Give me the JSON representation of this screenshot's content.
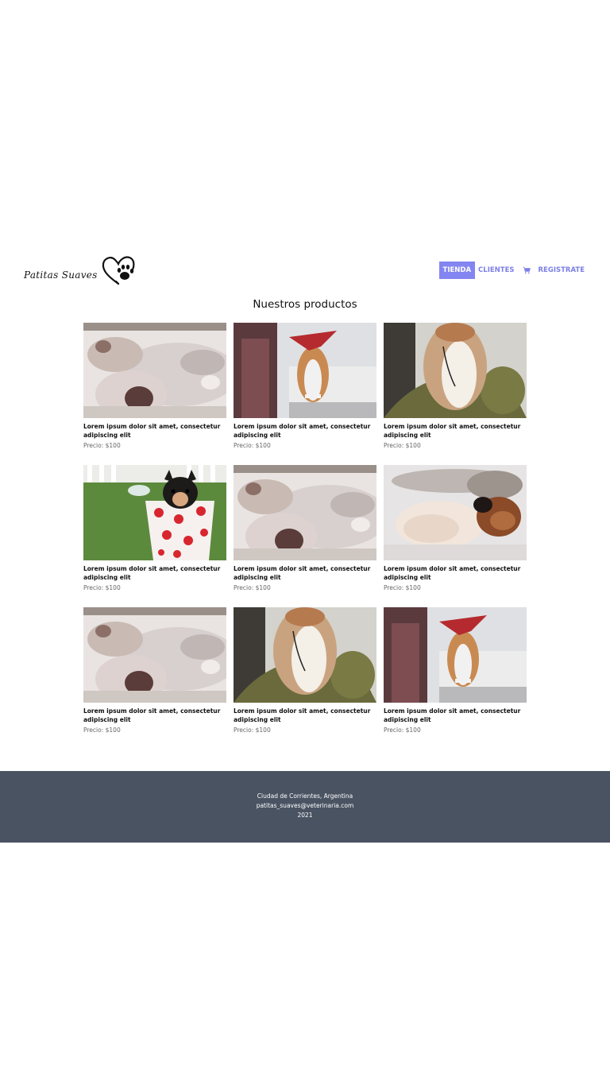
{
  "header": {
    "brand_name": "Patitas Suaves",
    "logo_icon": "heart-paw-icon",
    "nav": [
      {
        "label": "TIENDA",
        "active": true
      },
      {
        "label": "CLIENTES",
        "active": false
      },
      {
        "label": "REGISTRATE",
        "active": false,
        "icon": "cart-icon"
      }
    ]
  },
  "main": {
    "title": "Nuestros productos",
    "products": [
      {
        "image": "kitten-sleeping-photo",
        "description": "Lorem ipsum dolor sit amet, consectetur adipiscing elit",
        "price": "Precio: $100"
      },
      {
        "image": "cat-red-bandana-photo",
        "description": "Lorem ipsum dolor sit amet, consectetur adipiscing elit",
        "price": "Precio: $100"
      },
      {
        "image": "dog-on-chair-photo",
        "description": "Lorem ipsum dolor sit amet, consectetur adipiscing elit",
        "price": "Precio: $100"
      },
      {
        "image": "puppy-in-polka-dot-cup-photo",
        "description": "Lorem ipsum dolor sit amet, consectetur adipiscing elit",
        "price": "Precio: $100"
      },
      {
        "image": "kitten-sleeping-photo",
        "description": "Lorem ipsum dolor sit amet, consectetur adipiscing elit",
        "price": "Precio: $100"
      },
      {
        "image": "puppies-sleeping-photo",
        "description": "Lorem ipsum dolor sit amet, consectetur adipiscing elit",
        "price": "Precio: $100"
      },
      {
        "image": "kitten-sleeping-photo",
        "description": "Lorem ipsum dolor sit amet, consectetur adipiscing elit",
        "price": "Precio: $100"
      },
      {
        "image": "dog-on-chair-photo",
        "description": "Lorem ipsum dolor sit amet, consectetur adipiscing elit",
        "price": "Precio: $100"
      },
      {
        "image": "cat-red-bandana-photo",
        "description": "Lorem ipsum dolor sit amet, consectetur adipiscing elit",
        "price": "Precio: $100"
      }
    ]
  },
  "footer": {
    "location": "Ciudad de Corrientes, Argentina",
    "email": "patitas_suaves@veterinaria.com",
    "year": "2021"
  },
  "colors": {
    "nav_accent": "#8385f0",
    "nav_text": "#7c7fe6",
    "footer_bg": "#4a5362"
  }
}
